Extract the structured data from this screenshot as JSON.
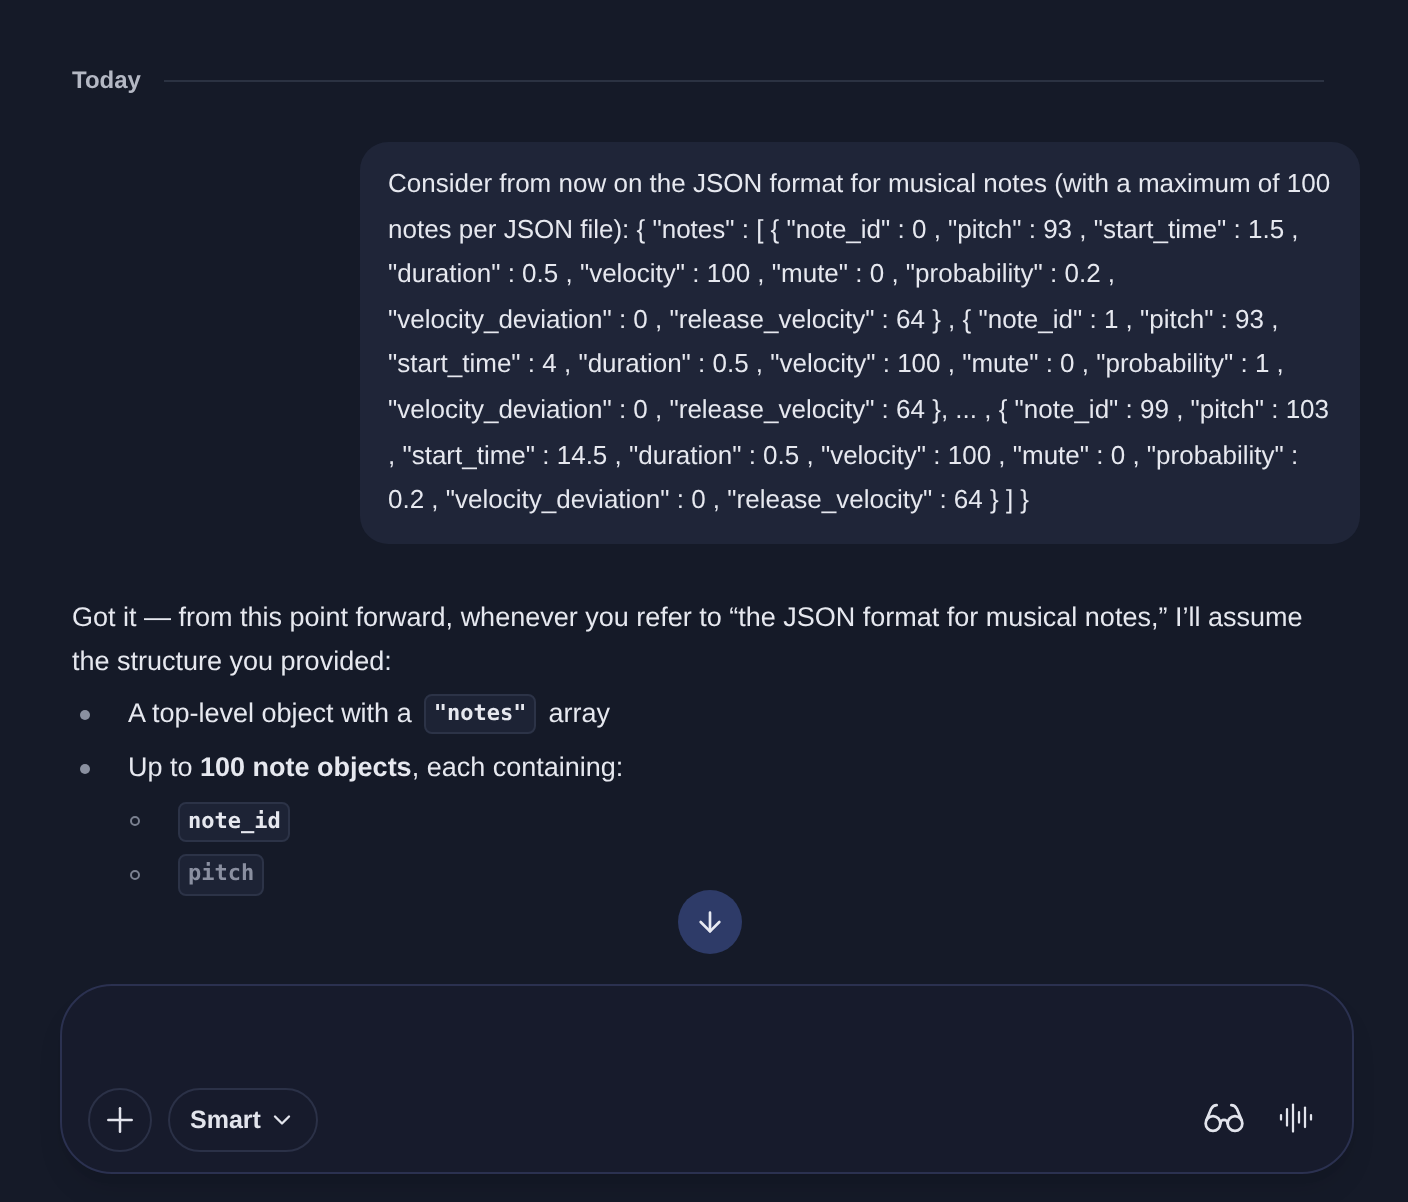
{
  "divider_label": "Today",
  "user_message": "Consider from now on the JSON format for musical notes (with a maximum of 100 notes per JSON file): { \"notes\" : [ { \"note_id\" : 0 , \"pitch\" : 93 , \"start_time\" : 1.5 , \"duration\" : 0.5 , \"velocity\" : 100 , \"mute\" : 0 , \"probability\" : 0.2 , \"velocity_deviation\" : 0 , \"release_velocity\" : 64 } , { \"note_id\" : 1 , \"pitch\" : 93 , \"start_time\" : 4 , \"duration\" : 0.5 , \"velocity\" : 100 , \"mute\" : 0 , \"probability\" : 1 , \"velocity_deviation\" : 0 , \"release_velocity\" : 64 }, ... , { \"note_id\" : 99 , \"pitch\" : 103 , \"start_time\" : 14.5 , \"duration\" : 0.5 , \"velocity\" : 100 , \"mute\" : 0 , \"probability\" : 0.2 , \"velocity_deviation\" : 0 , \"release_velocity\" : 64 } ] }",
  "assistant_message": {
    "intro": "Got it — from this point forward, whenever you refer to “the JSON format for musical notes,” I’ll assume the structure you provided:",
    "bullets": [
      {
        "parts": [
          {
            "kind": "text",
            "text": "A top-level object with a"
          },
          {
            "kind": "code",
            "text": "\"notes\""
          },
          {
            "kind": "text",
            "text": "array"
          }
        ]
      },
      {
        "parts": [
          {
            "kind": "text",
            "text": "Up to **100 note objects**, each containing:"
          }
        ],
        "children": [
          "note_id",
          "pitch"
        ]
      }
    ]
  },
  "composer": {
    "mode": "Smart"
  }
}
